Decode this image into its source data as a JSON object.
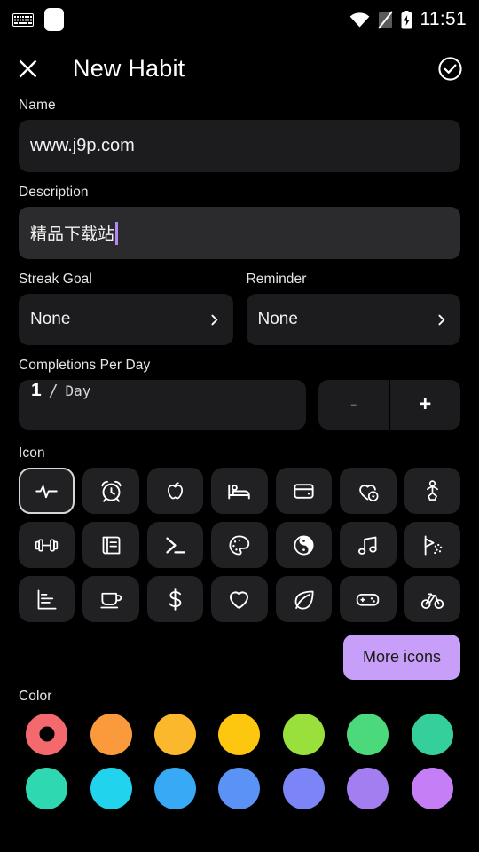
{
  "status_bar": {
    "time": "11:51",
    "icons": [
      "keyboard-icon",
      "white-square-indicator",
      "wifi-icon",
      "sim-off-icon",
      "battery-charging-icon"
    ]
  },
  "app_bar": {
    "close_label": "close-icon",
    "title": "New Habit",
    "confirm_label": "check-circle-icon"
  },
  "form": {
    "name": {
      "label": "Name",
      "value": "www.j9p.com"
    },
    "description": {
      "label": "Description",
      "value": "精品下载站"
    },
    "streak_goal": {
      "label": "Streak Goal",
      "value": "None"
    },
    "reminder": {
      "label": "Reminder",
      "value": "None"
    },
    "completions": {
      "label": "Completions Per Day",
      "count": "1",
      "separator": "/",
      "unit": "Day",
      "minus_label": "-",
      "plus_label": "+"
    }
  },
  "icon_section": {
    "label": "Icon",
    "more_button": "More icons",
    "selected_index": 0,
    "icons": [
      {
        "name": "pulse-icon"
      },
      {
        "name": "alarm-clock-icon"
      },
      {
        "name": "apple-icon"
      },
      {
        "name": "bed-icon"
      },
      {
        "name": "wallet-icon"
      },
      {
        "name": "heart-bolt-icon"
      },
      {
        "name": "baby-icon"
      },
      {
        "name": "dumbbell-icon"
      },
      {
        "name": "book-icon"
      },
      {
        "name": "terminal-icon"
      },
      {
        "name": "palette-icon"
      },
      {
        "name": "yin-yang-icon"
      },
      {
        "name": "music-note-icon"
      },
      {
        "name": "shower-icon"
      },
      {
        "name": "bar-chart-icon"
      },
      {
        "name": "coffee-cup-icon"
      },
      {
        "name": "dollar-icon"
      },
      {
        "name": "heart-icon"
      },
      {
        "name": "leaf-icon"
      },
      {
        "name": "gamepad-icon"
      },
      {
        "name": "bicycle-icon"
      }
    ]
  },
  "color_section": {
    "label": "Color",
    "selected_index": 0,
    "colors": [
      "#f4696e",
      "#fa9a3d",
      "#fbb82c",
      "#fdc60f",
      "#99e03c",
      "#4cd97b",
      "#35cf9b",
      "#2ed8b0",
      "#22d3ee",
      "#38aaf5",
      "#5b92f5",
      "#7b85f7",
      "#a27ef0",
      "#c57ef5"
    ]
  }
}
